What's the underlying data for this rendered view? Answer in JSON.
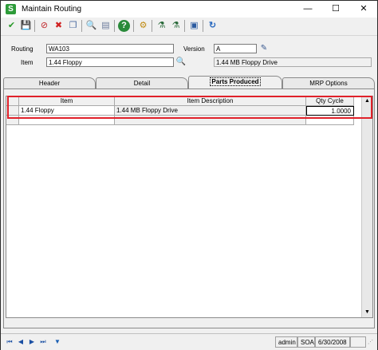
{
  "window": {
    "title": "Maintain Routing",
    "app_icon_letter": "S",
    "minimize": "—",
    "maximize": "☐",
    "close": "✕"
  },
  "toolbar": {
    "icons": [
      "accept-icon",
      "save-icon",
      "delete-icon",
      "cancel-icon",
      "copy-icon",
      "lookup-icon",
      "notes-icon",
      "help-icon",
      "cog-icon",
      "filter-icon",
      "clear-filter-icon",
      "memo-icon",
      "refresh-icon"
    ],
    "glyphs": [
      "✔",
      "💾",
      "⊘",
      "✖",
      "❐",
      "🔍",
      "▤",
      "?",
      "⚙",
      "⚗",
      "⚗",
      "▣",
      "↻"
    ]
  },
  "header": {
    "routing_label": "Routing",
    "routing_value": "WA103",
    "version_label": "Version",
    "version_value": "A",
    "item_label": "Item",
    "item_value": "1.44 Floppy",
    "item_description": "1.44 MB Floppy Drive"
  },
  "tabs": [
    {
      "label": "Header",
      "active": false
    },
    {
      "label": "Detail",
      "active": false
    },
    {
      "label": "Parts Produced",
      "active": true
    },
    {
      "label": "MRP Options",
      "active": false
    }
  ],
  "grid": {
    "columns": [
      "Item",
      "Item Description",
      "Qty Cycle"
    ],
    "rows": [
      {
        "item": "1.44 Floppy",
        "description": "1.44 MB Floppy Drive",
        "qty_cycle": "1.0000"
      }
    ]
  },
  "statusbar": {
    "user": "admin",
    "company": "SOA",
    "date": "6/30/2008"
  }
}
